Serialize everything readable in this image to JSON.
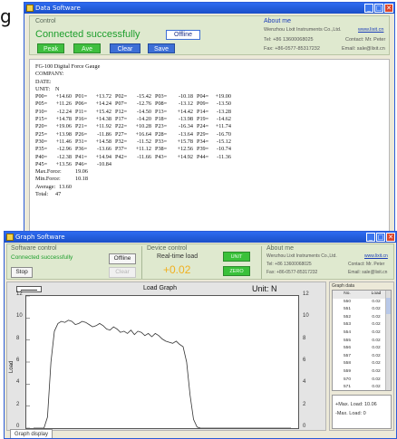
{
  "fragment_label": "g",
  "data_window": {
    "title": "Data Software",
    "control_label": "Control",
    "status": "Connected successfully",
    "offline_button": "Offline",
    "peak_button": "Peak",
    "ave_button": "Ave",
    "clear_button": "Clear",
    "save_button": "Save",
    "about_label": "About me",
    "company": "Wenzhou Lixit Instruments Co.,Ltd.",
    "website": "www.lixit.cn",
    "tel": "Tel: +86 13600068025",
    "contact": "Contact: Mr. Peter",
    "fax": "Fax: +86-0577-85317232",
    "email": "Email: sale@lixit.cn"
  },
  "report": {
    "header_lines": [
      "FG-100 Digital Force Gauge",
      "COMPANY:",
      "DATE:"
    ],
    "unit_label": "UNIT:",
    "unit_value": "N",
    "rows": [
      [
        "P00=",
        "+14.60",
        "P01=",
        "+13.72",
        "P02=",
        "-15.42",
        "P03=",
        "-10.18",
        "P04=",
        "+19.00"
      ],
      [
        "P05=",
        "+11.26",
        "P06=",
        "+14.24",
        "P07=",
        "-12.76",
        "P08=",
        "-13.12",
        "P09=",
        "-13.50"
      ],
      [
        "P10=",
        "-12.24",
        "P11=",
        "+15.42",
        "P12=",
        "-14.50",
        "P13=",
        "+14.42",
        "P14=",
        "-13.28"
      ],
      [
        "P15=",
        "+14.78",
        "P16=",
        "+14.38",
        "P17=",
        "-14.20",
        "P18=",
        "-13.98",
        "P19=",
        "-14.62"
      ],
      [
        "P20=",
        "+19.06",
        "P21=",
        "+11.92",
        "P22=",
        "+10.28",
        "P23=",
        "-16.34",
        "P24=",
        "+11.74"
      ],
      [
        "P25=",
        "+13.98",
        "P26=",
        "-11.86",
        "P27=",
        "+16.64",
        "P28=",
        "-13.64",
        "P29=",
        "-16.70"
      ],
      [
        "P30=",
        "+11.46",
        "P31=",
        "+14.58",
        "P32=",
        "-11.52",
        "P33=",
        "+15.78",
        "P34=",
        "-15.12"
      ],
      [
        "P35=",
        "-12.96",
        "P36=",
        "-13.66",
        "P37=",
        "+11.12",
        "P38=",
        "+12.56",
        "P39=",
        "-10.74"
      ],
      [
        "P40=",
        "-12.38",
        "P41=",
        "+14.94",
        "P42=",
        "-11.66",
        "P43=",
        "+14.92",
        "P44=",
        "-11.36"
      ],
      [
        "P45=",
        "+13.56",
        "P46=",
        "-10.84",
        "",
        "",
        "",
        "",
        "",
        ""
      ]
    ],
    "max_label": "Max.Force:",
    "max_value": "19.06",
    "min_label": "Min.Force:",
    "min_value": "10.18",
    "avg_label": "Average:",
    "avg_value": "13.60",
    "total_label": "Total:",
    "total_value": "47"
  },
  "graph_window": {
    "title": "Graph Software",
    "software_control_label": "Software control",
    "status": "Connected successfully",
    "offline_button": "Offline",
    "stop_button": "Stop",
    "clear_button": "Clear",
    "device_control_label": "Device control",
    "realtime_label": "Real-time load",
    "realtime_value": "+0.02",
    "unit_button": "UNIT",
    "zero_button": "ZERO",
    "about_label": "About me",
    "company": "Wenzhou Lixit Instruments Co.,Ltd.",
    "website": "www.lixit.cn",
    "tel": "Tel: +86 13600068025",
    "contact": "Contact: Mr. Peter",
    "fax": "Fax: +86-0577-85317232",
    "email": "Email: sale@lixit.cn",
    "graph_data_label": "Graph data",
    "table_header": [
      "No.",
      "Load"
    ],
    "table_rows": [
      [
        "550",
        "0.02"
      ],
      [
        "551",
        "0.02"
      ],
      [
        "552",
        "0.02"
      ],
      [
        "553",
        "0.02"
      ],
      [
        "554",
        "0.02"
      ],
      [
        "555",
        "0.02"
      ],
      [
        "556",
        "0.02"
      ],
      [
        "557",
        "0.02"
      ],
      [
        "558",
        "0.02"
      ],
      [
        "559",
        "0.02"
      ],
      [
        "570",
        "0.02"
      ],
      [
        "571",
        "0.02"
      ]
    ],
    "max_load_label": "+Max. Load:",
    "max_load_value": "10.06",
    "min_load_label": "-Max. Load:",
    "min_load_value": "0",
    "tab_label": "Graph display"
  },
  "chart_data": {
    "type": "line",
    "title": "Load Graph",
    "unit_label": "Unit:",
    "unit_value": "N",
    "ylabel": "Load",
    "ylim": [
      0,
      12
    ],
    "yticks": [
      0,
      2,
      4,
      6,
      8,
      10,
      12
    ],
    "grid": false,
    "line_color": "#333333",
    "series": [
      {
        "values": [
          0,
          0,
          0,
          0,
          1.0,
          6.0,
          8.8,
          9.5,
          9.7,
          9.6,
          9.8,
          9.7,
          9.4,
          9.5,
          9.7,
          9.6,
          9.4,
          9.2,
          9.3,
          9.5,
          9.3,
          9.0,
          8.9,
          9.2,
          9.0,
          8.7,
          8.8,
          8.6,
          8.9,
          8.5,
          8.8,
          8.7,
          8.4,
          8.6,
          8.3,
          8.6,
          8.4,
          8.1,
          7.9,
          7.8,
          7.7,
          7.9,
          7.6,
          7.4,
          6.0,
          3.0,
          0.8,
          0.1,
          0,
          0,
          0,
          0,
          0,
          0,
          0,
          0,
          0,
          0,
          0,
          0,
          0,
          0,
          0,
          0,
          0,
          0,
          0,
          0,
          0,
          0,
          0,
          0,
          0,
          0,
          0
        ]
      }
    ]
  }
}
